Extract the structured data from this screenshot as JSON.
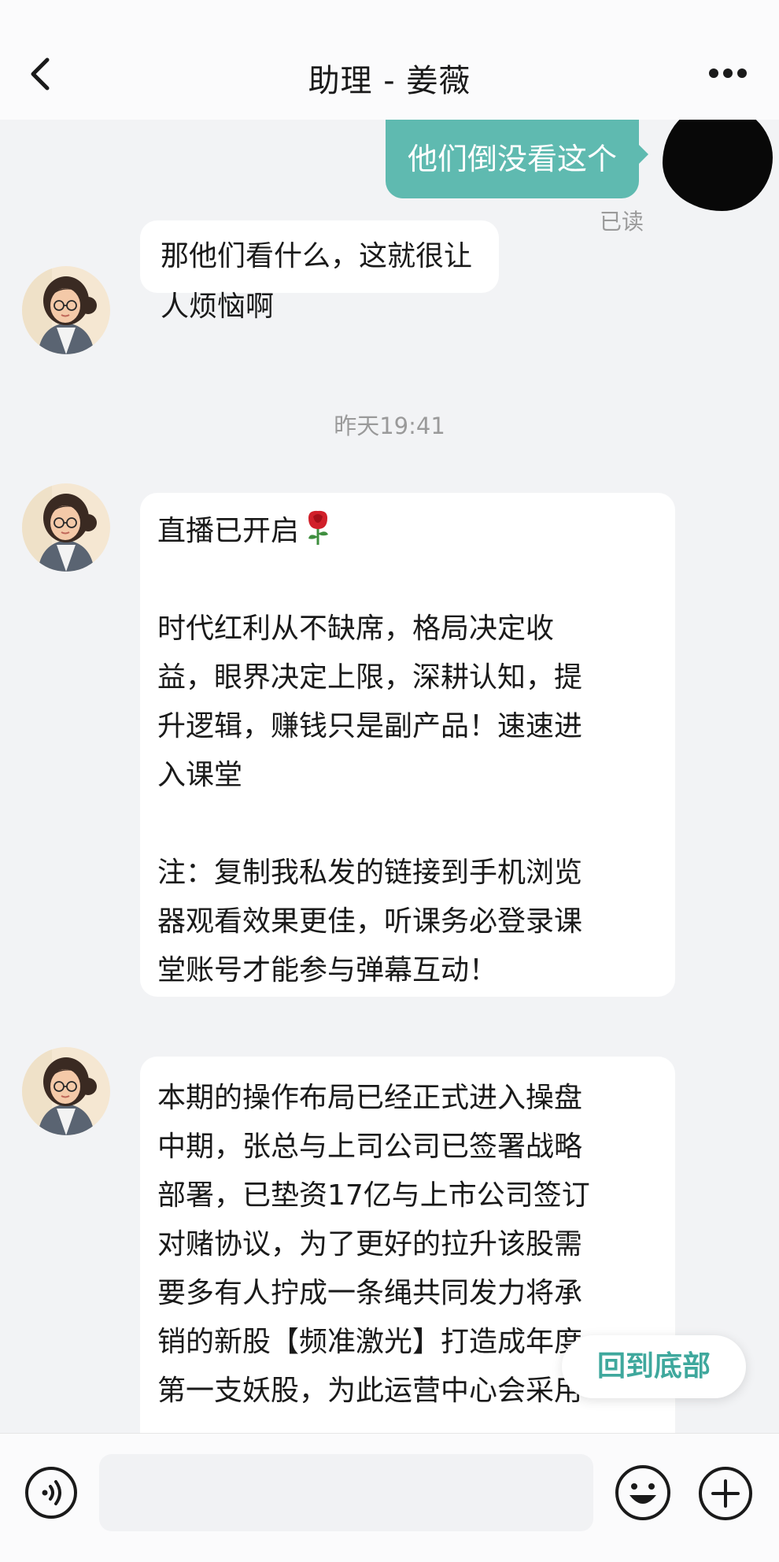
{
  "header": {
    "title": "助理 - 姜薇",
    "back_icon": "chevron-left-icon",
    "more_icon": "more-dots-icon"
  },
  "messages": {
    "outgoing_text": "他们倒没看这个",
    "read_receipt": "已读",
    "incoming_1": "那他们看什么，这就很让人烦恼啊",
    "timestamp": "昨天19:41",
    "incoming_2": {
      "line1": "直播已开启",
      "para2_l1": "时代红利从不缺席，格局决定收",
      "para2_l2": "益，眼界决定上限，深耕认知，提",
      "para2_l3": "升逻辑，赚钱只是副产品！速速进",
      "para2_l4": "入课堂",
      "para3_l1": "注：复制我私发的链接到手机浏览",
      "para3_l2": "器观看效果更佳，听课务必登录课",
      "para3_l3": "堂账号才能参与弹幕互动！"
    },
    "incoming_3": {
      "l1": "本期的操作布局已经正式进入操盘",
      "l2": "中期，张总与上司公司已签署战略",
      "l3": "部署，已垫资17亿与上市公司签订",
      "l4": "对赌协议，为了更好的拉升该股需",
      "l5": "要多有人拧成一条绳共同发力将承",
      "l6": "销的新股【频准激光】打造成年度",
      "l7": "第一支妖股，为此运营中心会采用"
    }
  },
  "back_to_bottom_label": "回到底部",
  "input": {
    "placeholder": "",
    "voice_icon": "voice-icon",
    "emoji_icon": "emoji-icon",
    "plus_icon": "plus-icon"
  },
  "colors": {
    "accent": "#5fbab0",
    "accent_text": "#3fa89d",
    "background": "#f2f3f5",
    "bubble_in": "#ffffff"
  }
}
